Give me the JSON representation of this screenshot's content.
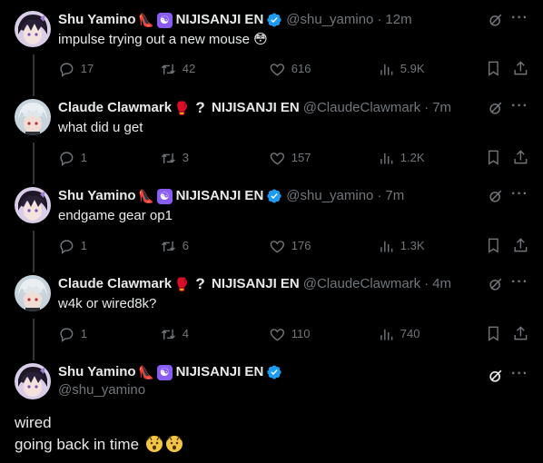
{
  "tweets": [
    {
      "name": "Shu Yamino",
      "emoji1": "👠",
      "emoji2": "☯",
      "affiliation": "NIJISANJI EN",
      "handle": "@shu_yamino",
      "time": "12m",
      "text": "impulse trying out a new mouse 😳",
      "replies": "17",
      "retweets": "42",
      "likes": "616",
      "views": "5.9K"
    },
    {
      "name": "Claude Clawmark",
      "emoji1": "🥊",
      "emoji2": "?",
      "affiliation": "NIJISANJI EN",
      "handle": "@ClaudeClawmark",
      "time": "7m",
      "text": "what did u get",
      "replies": "1",
      "retweets": "3",
      "likes": "157",
      "views": "1.2K"
    },
    {
      "name": "Shu Yamino",
      "emoji1": "👠",
      "emoji2": "☯",
      "affiliation": "NIJISANJI EN",
      "handle": "@shu_yamino",
      "time": "7m",
      "text": "endgame gear op1",
      "replies": "1",
      "retweets": "6",
      "likes": "176",
      "views": "1.3K"
    },
    {
      "name": "Claude Clawmark",
      "emoji1": "🥊",
      "emoji2": "?",
      "affiliation": "NIJISANJI EN",
      "handle": "@ClaudeClawmark",
      "time": "4m",
      "text": "w4k or wired8k?",
      "replies": "1",
      "retweets": "4",
      "likes": "110",
      "views": "740"
    }
  ],
  "main_tweet": {
    "name": "Shu Yamino",
    "emoji1": "👠",
    "emoji2": "☯",
    "affiliation": "NIJISANJI EN",
    "handle": "@shu_yamino",
    "line1": "wired",
    "line2": "going back in time"
  },
  "icons": {
    "reply": "reply-icon",
    "retweet": "retweet-icon",
    "like": "heart-icon",
    "views": "views-icon",
    "bookmark": "bookmark-icon",
    "share": "share-icon",
    "grok": "grok-icon",
    "more": "more-icon",
    "verified": "verified-badge-icon"
  },
  "colors": {
    "background": "#000000",
    "text": "#e7e9ea",
    "muted": "#71767b",
    "verified": "#1d9bf0",
    "thread_line": "#333639"
  }
}
